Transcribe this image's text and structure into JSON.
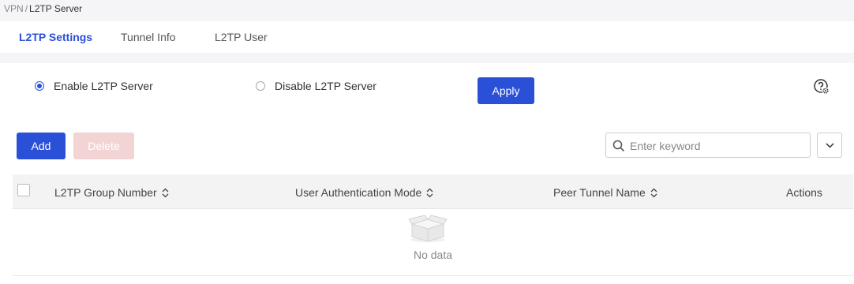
{
  "breadcrumb": {
    "parent": "VPN",
    "separator": "/",
    "current": "L2TP Server"
  },
  "tabs": [
    {
      "label": "L2TP Settings",
      "active": true
    },
    {
      "label": "Tunnel Info",
      "active": false
    },
    {
      "label": "L2TP User",
      "active": false
    }
  ],
  "server_mode": {
    "enable_label": "Enable L2TP Server",
    "disable_label": "Disable L2TP Server",
    "selected": "enable"
  },
  "apply_label": "Apply",
  "toolbar": {
    "add_label": "Add",
    "delete_label": "Delete"
  },
  "search": {
    "placeholder": "Enter keyword",
    "value": ""
  },
  "table": {
    "columns": [
      "L2TP Group Number",
      "User Authentication Mode",
      "Peer Tunnel Name",
      "Actions"
    ],
    "rows": [],
    "empty_text": "No data"
  },
  "colors": {
    "accent": "#2b50d8",
    "disabled": "#f3d4d4"
  }
}
